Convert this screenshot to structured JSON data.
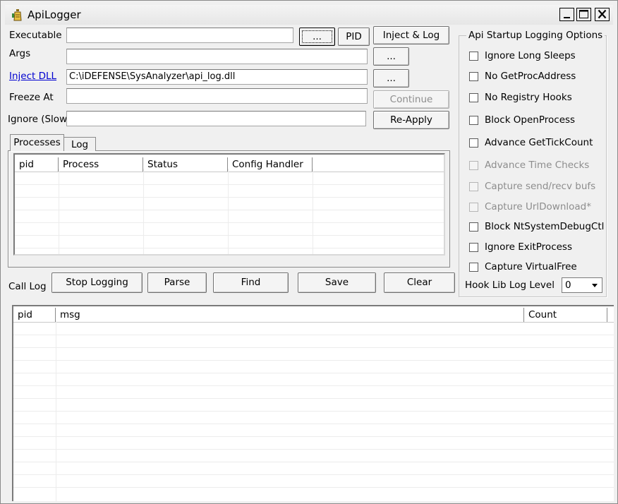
{
  "window": {
    "title": "ApiLogger",
    "icon": "app-icon",
    "controls": [
      "minimize-icon",
      "maximize-icon",
      "close-icon"
    ]
  },
  "form": {
    "executable_label": "Executable",
    "executable_value": "",
    "browse_exe_label": "...",
    "pid_label": "PID",
    "inject_log_label": "Inject & Log",
    "args_label": "Args",
    "args_value": "",
    "browse_args_label": "...",
    "inject_dll_label": "Inject DLL",
    "inject_dll_value": "C:\\iDEFENSE\\SysAnalyzer\\api_log.dll",
    "browse_dll_label": "...",
    "freeze_at_label": "Freeze At",
    "freeze_at_value": "",
    "continue_label": "Continue",
    "ignore_slow_label": "Ignore (Slow)",
    "ignore_slow_value": "",
    "reapply_label": "Re-Apply"
  },
  "tabs": [
    {
      "label": "Processes",
      "selected": true
    },
    {
      "label": "Log",
      "selected": false
    }
  ],
  "processes_table": {
    "columns": [
      "pid",
      "Process",
      "Status",
      "Config Handler"
    ],
    "rows": []
  },
  "options": {
    "title": "Api Startup Logging Options",
    "items": [
      {
        "label": "Ignore Long Sleeps",
        "checked": false,
        "enabled": true
      },
      {
        "label": "No GetProcAddress",
        "checked": false,
        "enabled": true
      },
      {
        "label": "No Registry Hooks",
        "checked": false,
        "enabled": true
      },
      {
        "label": "Block OpenProcess",
        "checked": false,
        "enabled": true
      },
      {
        "label": "Advance GetTickCount",
        "checked": false,
        "enabled": true
      },
      {
        "label": "Advance Time Checks",
        "checked": false,
        "enabled": false
      },
      {
        "label": "Capture send/recv bufs",
        "checked": false,
        "enabled": false
      },
      {
        "label": "Capture UrlDownload*",
        "checked": false,
        "enabled": false
      },
      {
        "label": "Block NtSystemDebugCtl",
        "checked": false,
        "enabled": true
      },
      {
        "label": "Ignore ExitProcess",
        "checked": false,
        "enabled": true
      },
      {
        "label": "Capture VirtualFree",
        "checked": false,
        "enabled": true
      }
    ],
    "hook_level_label": "Hook Lib Log Level",
    "hook_level_value": "0"
  },
  "call_log": {
    "label": "Call Log",
    "buttons": {
      "stop_logging": "Stop Logging",
      "parse": "Parse",
      "find": "Find",
      "save": "Save",
      "clear": "Clear"
    },
    "columns": [
      "pid",
      "msg",
      "Count"
    ],
    "rows": []
  }
}
